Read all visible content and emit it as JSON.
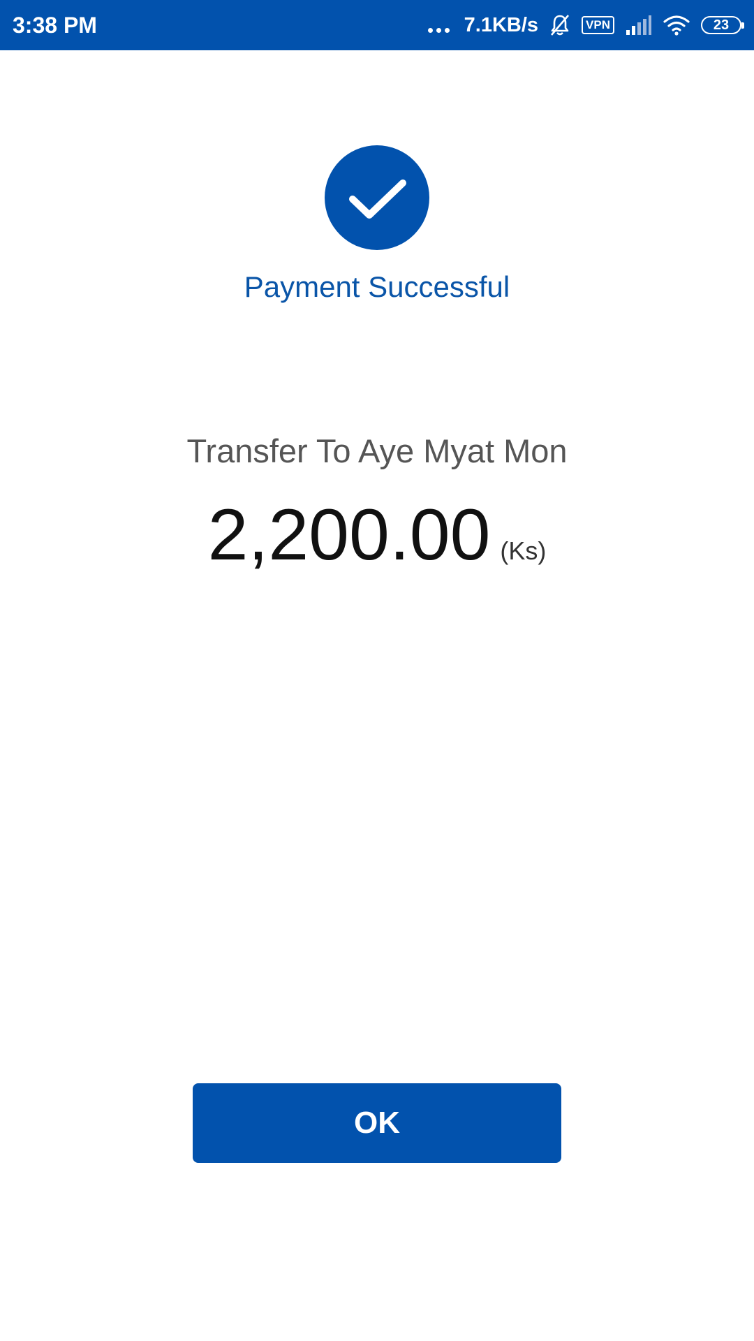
{
  "status_bar": {
    "time": "3:38 PM",
    "net_speed": "7.1KB/s",
    "vpn_label": "VPN",
    "battery_level": "23",
    "icons": [
      "more-dots-icon",
      "bell-muted-icon",
      "vpn-icon",
      "signal-icon",
      "wifi-icon",
      "battery-icon"
    ]
  },
  "success": {
    "icon": "checkmark-icon",
    "title": "Payment Successful"
  },
  "transfer": {
    "label": "Transfer To Aye Myat Mon",
    "amount": "2,200.00",
    "currency": "(Ks)"
  },
  "actions": {
    "ok_label": "OK"
  },
  "colors": {
    "brand_blue": "#0252ad",
    "title_blue": "#0a55a8",
    "label_gray": "#555555",
    "amount_black": "#111111"
  }
}
